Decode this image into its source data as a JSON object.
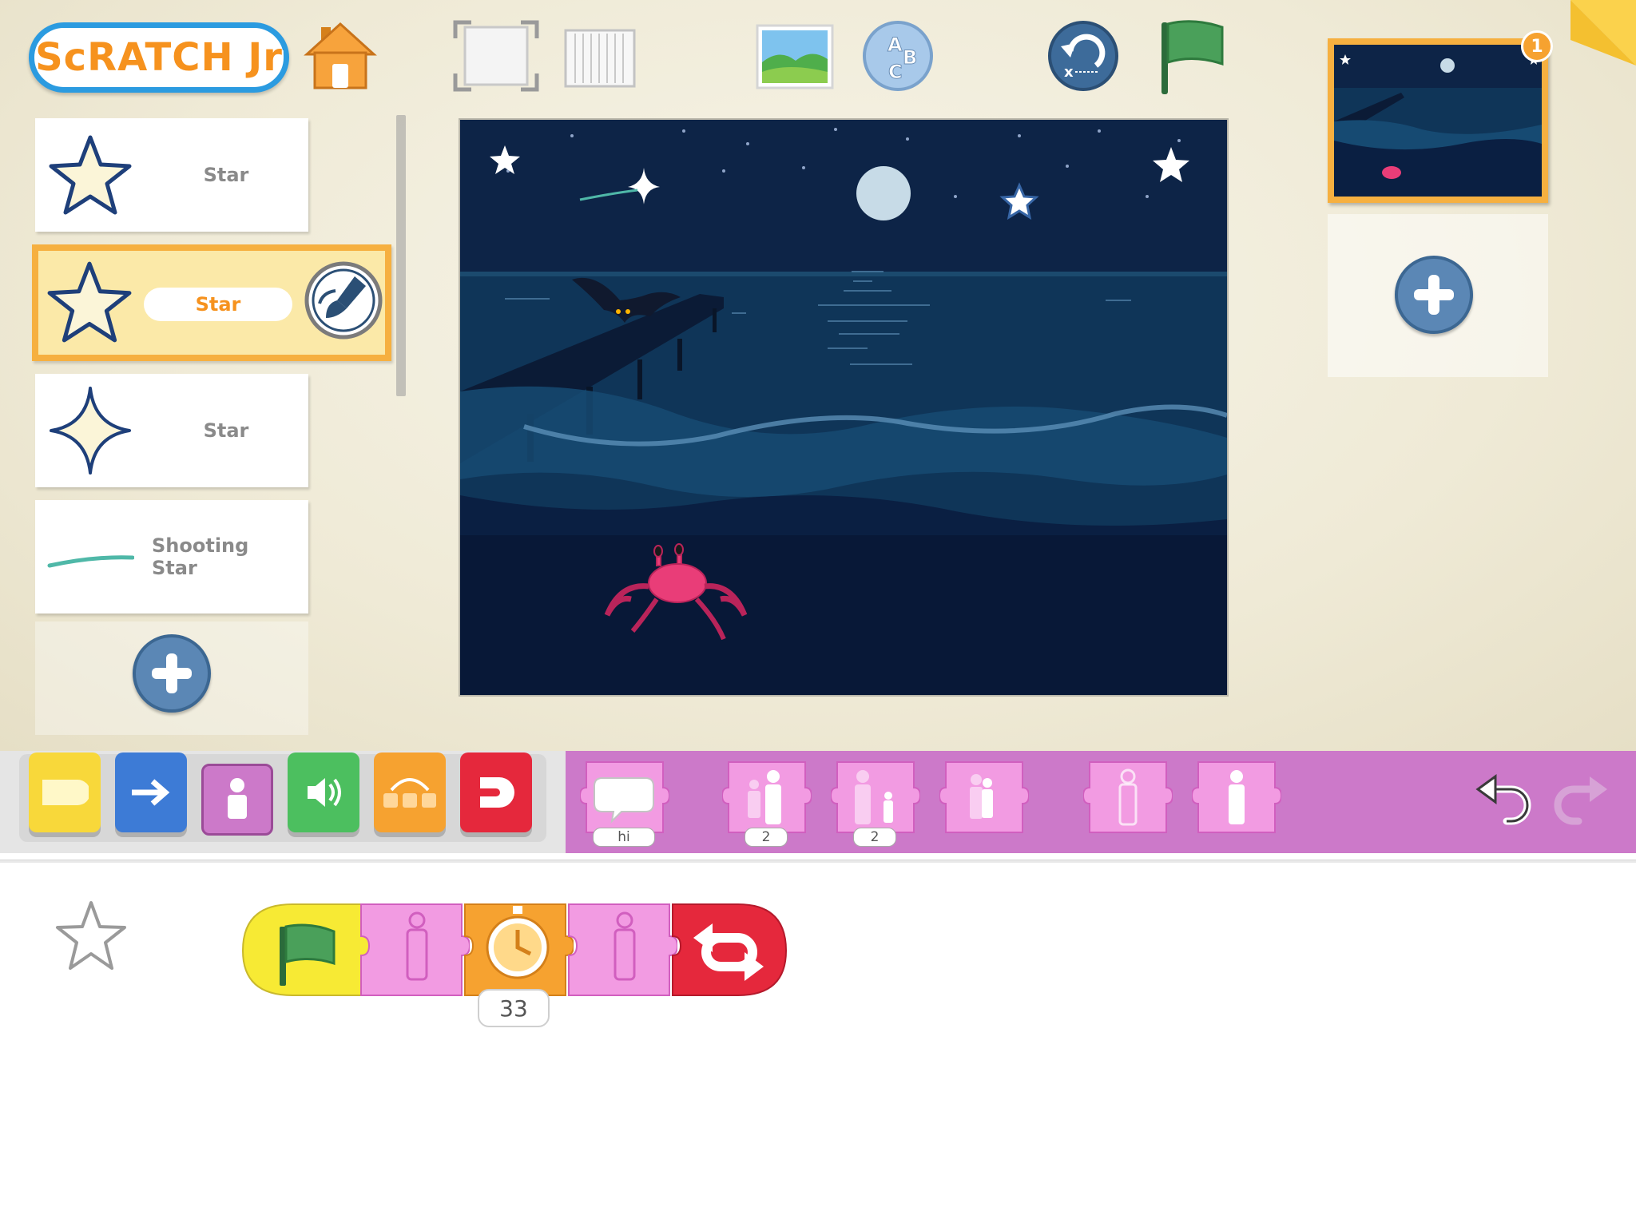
{
  "app": {
    "logo_text": "ScRATCH Jr"
  },
  "sprites": [
    {
      "name": "Star",
      "icon": "star-icon",
      "selected": false
    },
    {
      "name": "Star",
      "icon": "star-icon",
      "selected": true
    },
    {
      "name": "Star",
      "icon": "twinkle-star-icon",
      "selected": false
    },
    {
      "name": "Shooting Star",
      "icon": "shooting-star-icon",
      "selected": false
    }
  ],
  "pages": {
    "badge": "1"
  },
  "palette": {
    "categories": [
      "triggering",
      "motion",
      "looks",
      "sound",
      "control",
      "end"
    ],
    "active_category": "looks",
    "say_label": "hi",
    "grow_value": "2",
    "shrink_value": "2"
  },
  "script": {
    "wait_value": "33"
  },
  "colors": {
    "accent_orange": "#f6921e",
    "looks_pink": "#f08fdc",
    "palette_purple": "#cc79c9",
    "stage_night": "#0e2447"
  }
}
